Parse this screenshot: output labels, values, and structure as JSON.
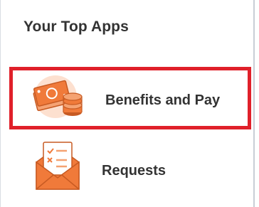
{
  "panel": {
    "title": "Your Top Apps",
    "apps": [
      {
        "label": "Benefits and Pay",
        "icon": "money-bills-coins-icon",
        "highlighted": true
      },
      {
        "label": "Requests",
        "icon": "envelope-checklist-icon",
        "highlighted": false
      }
    ]
  },
  "colors": {
    "highlight_border": "#e0202a",
    "icon_orange": "#f07a3a",
    "icon_light": "#fde0cf",
    "text": "#333333"
  }
}
